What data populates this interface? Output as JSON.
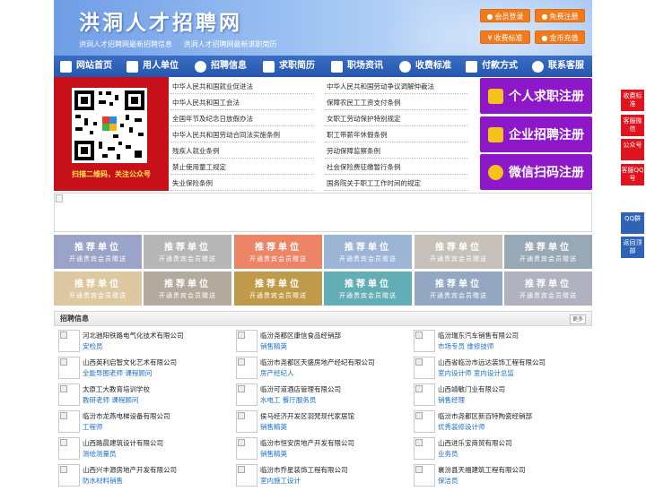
{
  "header": {
    "site_title": "洪洞人才招聘网",
    "subtitle_1": "洪洞人才招聘网最新招聘信息",
    "subtitle_2": "洪洞人才招聘网最新求职简历",
    "buttons": {
      "member_login": "会员登录",
      "free_register": "免费注册",
      "fee_standard": "收费标准",
      "gold_recharge": "金币充值"
    }
  },
  "nav": {
    "items": [
      "网站首页",
      "用人单位",
      "招聘信息",
      "求职简历",
      "职场资讯",
      "收费标准",
      "付款方式",
      "联系客服"
    ]
  },
  "qr": {
    "caption": "扫描二维码，关注公众号"
  },
  "laws": [
    "中华人民共和国就业促进法",
    "中华人民共和国劳动争议调解仲裁法",
    "中华人民共和国工会法",
    "保障农民工工资支付条例",
    "全国年节及纪念日放假办法",
    "女职工劳动保护特别规定",
    "中华人民共和国劳动合同法实施条例",
    "职工带薪年休假条例",
    "残疾人就业条例",
    "劳动保障监察条例",
    "禁止使用童工规定",
    "社会保险费征缴暂行条例",
    "失业保险条例",
    "国务院关于职工工作时间的规定"
  ],
  "register": {
    "personal": "个人求职注册",
    "company": "企业招聘注册",
    "wechat": "微信扫码注册"
  },
  "recommend": {
    "title": "推荐单位",
    "subtitle": "开通贵宾会员赠送",
    "colors": [
      "#9aa3c8",
      "#b6b6b6",
      "#ec8466",
      "#9cb4d6",
      "#c5c1b8",
      "#97a9b4",
      "#ddc8a2",
      "#b3a99d",
      "#bf9a48",
      "#63aeb6",
      "#93a6c2",
      "#b1b1bf"
    ]
  },
  "jobs": {
    "section_title": "招聘信息",
    "more_label": "更多",
    "list": [
      {
        "company": "河北驰阳铁路电气化技术有限公司",
        "positions": "安检员"
      },
      {
        "company": "临汾尧都区康信食品经销部",
        "positions": "销售精英"
      },
      {
        "company": "临汾瑞东汽车销售有限公司",
        "positions": "市场专员 维修技师"
      },
      {
        "company": "山西英利启智文化艺术有限公司",
        "positions": "全能导图老师 课程顾问"
      },
      {
        "company": "临汾市尧都区天盛房地产经纪有限公司",
        "positions": "房产经纪人"
      },
      {
        "company": "山西省临汾市远达装饰工程有限公司",
        "positions": "室内设计师 室内设计总监"
      },
      {
        "company": "太原工大教育培训学校",
        "positions": "教研老师 课程顾问"
      },
      {
        "company": "临汾可道酒店管理有限公司",
        "positions": "水电工 餐厅服务员"
      },
      {
        "company": "山西靖敏门业有限公司",
        "positions": "销售经理"
      },
      {
        "company": "临汾市龙燕电梯设备有限公司",
        "positions": "工程师"
      },
      {
        "company": "侯马经济开发区羽梵现代家居馆",
        "positions": "销售精英"
      },
      {
        "company": "临汾市尧都区新百特陶瓷经销部",
        "positions": "优秀装修设计师"
      },
      {
        "company": "山西路晨建筑设计有限公司",
        "positions": "测绘测量员"
      },
      {
        "company": "临汾市恒安房地产开发有限公司",
        "positions": "销售精英"
      },
      {
        "company": "山西进乐宝商贸有限公司",
        "positions": "业务员"
      },
      {
        "company": "山西兴丰源房地产开发有限公司",
        "positions": "防水材料销售"
      },
      {
        "company": "临汾市乔星装饰工程有限公司",
        "positions": "室内施工设计"
      },
      {
        "company": "襄汾县天福建筑工程有限公司",
        "positions": "保洁员"
      }
    ]
  },
  "float_tabs": [
    {
      "label": "收费标准",
      "color": "#e0141e"
    },
    {
      "label": "客服微信",
      "color": "#e0141e"
    },
    {
      "label": "公众号",
      "color": "#e0141e"
    },
    {
      "label": "客服QQ号",
      "color": "#e0141e"
    },
    {
      "label": "QQ群",
      "color": "#2e63b8"
    },
    {
      "label": "返回顶部",
      "color": "#2e63b8"
    }
  ]
}
